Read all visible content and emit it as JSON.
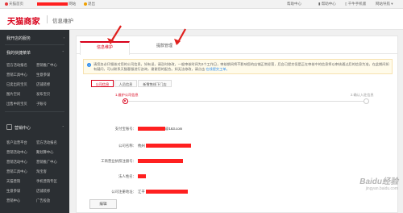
{
  "topbar": {
    "home": "天猫首页",
    "user_suffix": "网站",
    "logout": "退出",
    "help": "帮助中心",
    "messages": "帮助中心",
    "brand_link": "千牛手机版",
    "mobile": "千牛手机版",
    "site_nav": "网站导航"
  },
  "header": {
    "logo": "天猫商家",
    "title": "信息维护"
  },
  "sidebar": {
    "section1": "我开店的服务",
    "section2": "我的快捷菜单",
    "links": [
      [
        "官方活动报名",
        "营销推广中心"
      ],
      [
        "营销工具中心",
        "生意参谋"
      ],
      [
        "已卖出的宝贝",
        "店铺装修"
      ],
      [
        "图片空间",
        "发布宝贝"
      ],
      [
        "出售中的宝贝",
        "子账号"
      ]
    ],
    "section3": "营销中心",
    "links2": [
      [
        "客户运营平台",
        "官方活动报名"
      ],
      [
        "营销活动中心",
        "聚划算中心"
      ],
      [
        "营销活动中心",
        "营销推广中心"
      ],
      [
        "营销工具中心",
        "淘宝客"
      ],
      [
        "天猫营销",
        "手机营销专区"
      ],
      [
        "生意参谋",
        "店铺装修"
      ],
      [
        "营销中心",
        "广告投放"
      ]
    ]
  },
  "tabs": [
    "信息维护",
    "提款管理"
  ],
  "notice": {
    "text": "请您务必仔细核对您的公司信息，如有误，请及时修改，一般审核时间为3个工作日，审核期间将不影响您的店铺正常经营，后台已提交但是正在审核中的信息将以审核通过后的信息为准，在此期间如有疑问，可以联系天猫客服进行咨询，谢谢您的配合。如无法修改，请点击 ",
    "link": "在线提交工单。"
  },
  "subtabs": [
    "公司信息",
    "人员信息",
    "新零售线下门店"
  ],
  "steps": [
    "1.维护公司信息",
    "2.确认入驻信息"
  ],
  "form": [
    {
      "label": "支付宝账号：",
      "value": "@163.com"
    },
    {
      "label": "公司名称：",
      "value": "杭州"
    },
    {
      "label": "工商营业执照注册号：",
      "value": ""
    },
    {
      "label": "法人姓名：",
      "value": ""
    },
    {
      "label": "公司注册地址：",
      "value": "江干"
    }
  ],
  "edit_button": "编辑",
  "watermark": {
    "main": "Baidu经验",
    "sub": "jingyan.baidu.com"
  }
}
